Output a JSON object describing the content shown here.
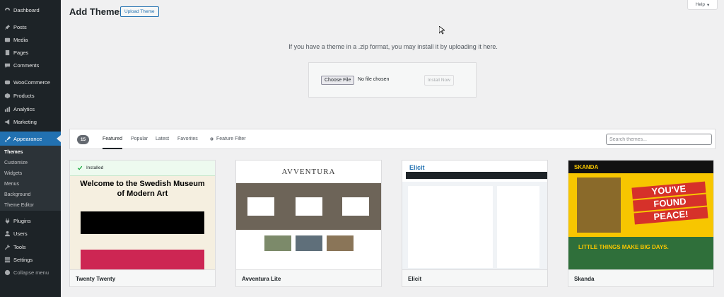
{
  "sidebar": {
    "items": [
      {
        "label": "Dashboard",
        "icon": "dashboard-icon"
      },
      {
        "label": "Posts",
        "icon": "pin-icon"
      },
      {
        "label": "Media",
        "icon": "media-icon"
      },
      {
        "label": "Pages",
        "icon": "pages-icon"
      },
      {
        "label": "Comments",
        "icon": "comments-icon"
      },
      {
        "label": "WooCommerce",
        "icon": "woocommerce-icon"
      },
      {
        "label": "Products",
        "icon": "products-icon"
      },
      {
        "label": "Analytics",
        "icon": "analytics-icon"
      },
      {
        "label": "Marketing",
        "icon": "marketing-icon"
      },
      {
        "label": "Appearance",
        "icon": "appearance-icon",
        "active": true
      },
      {
        "label": "Plugins",
        "icon": "plugins-icon"
      },
      {
        "label": "Users",
        "icon": "users-icon"
      },
      {
        "label": "Tools",
        "icon": "tools-icon"
      },
      {
        "label": "Settings",
        "icon": "settings-icon"
      },
      {
        "label": "Collapse menu",
        "icon": "collapse-icon"
      }
    ],
    "submenu": [
      "Themes",
      "Customize",
      "Widgets",
      "Menus",
      "Background",
      "Theme Editor"
    ],
    "current_submenu": "Themes"
  },
  "header": {
    "title": "Add Themes",
    "upload_label": "Upload Theme",
    "help_label": "Help"
  },
  "upload": {
    "message": "If you have a theme in a .zip format, you may install it by uploading it here.",
    "choose_label": "Choose File",
    "no_file": "No file chosen",
    "install_label": "Install Now"
  },
  "filter": {
    "count": "15",
    "tabs": [
      "Featured",
      "Popular",
      "Latest",
      "Favorites"
    ],
    "current_tab": "Featured",
    "feature_filter": "Feature Filter",
    "search_placeholder": "Search themes..."
  },
  "themes": [
    {
      "name": "Twenty Twenty",
      "installed": "Installed",
      "preview_heading": "Welcome to the Swedish Museum of Modern Art"
    },
    {
      "name": "Avventura Lite",
      "preview_logo": "AVVENTURA"
    },
    {
      "name": "Elicit",
      "preview_logo": "Elicit"
    },
    {
      "name": "Skanda",
      "preview_logo": "SKANDA",
      "preview_banner": [
        "YOU'VE",
        "FOUND",
        "PEACE!"
      ],
      "preview_tagline": "LITTLE THINGS MAKE BIG DAYS."
    }
  ],
  "colors": {
    "sidebar_bg": "#1d2327",
    "accent": "#2271b1",
    "installed_check": "#00a32a"
  }
}
